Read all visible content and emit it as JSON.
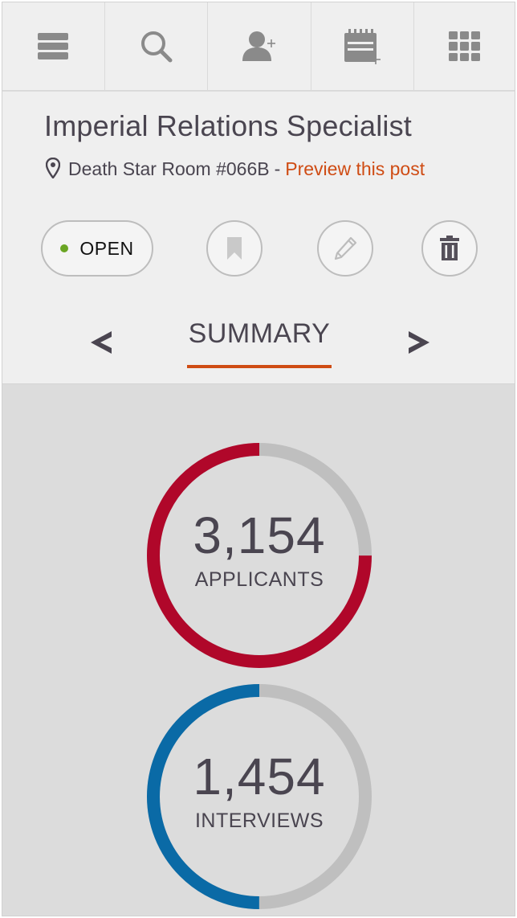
{
  "toolbar": {
    "items": [
      {
        "icon": "menu-icon"
      },
      {
        "icon": "search-icon"
      },
      {
        "icon": "add-user-icon"
      },
      {
        "icon": "calendar-add-icon"
      },
      {
        "icon": "grid-icon"
      }
    ]
  },
  "job": {
    "title": "Imperial Relations Specialist",
    "location": "Death Star Room #066B",
    "separator": "-",
    "preview_label": "Preview this post"
  },
  "actions": {
    "status_label": "OPEN",
    "status_color": "#6aa523",
    "buttons": [
      "bookmark-icon",
      "pencil-icon",
      "trash-icon"
    ]
  },
  "nav": {
    "tab_label": "SUMMARY",
    "prev_icon": "chevron-left-icon",
    "next_icon": "chevron-right-icon",
    "accent_color": "#cf4c14"
  },
  "stats": [
    {
      "number": "3,154",
      "label": "APPLICANTS",
      "progress": 0.75,
      "color": "#b0072a"
    },
    {
      "number": "1,454",
      "label": "INTERVIEWS",
      "progress": 0.5,
      "color": "#0a6aa6"
    }
  ]
}
